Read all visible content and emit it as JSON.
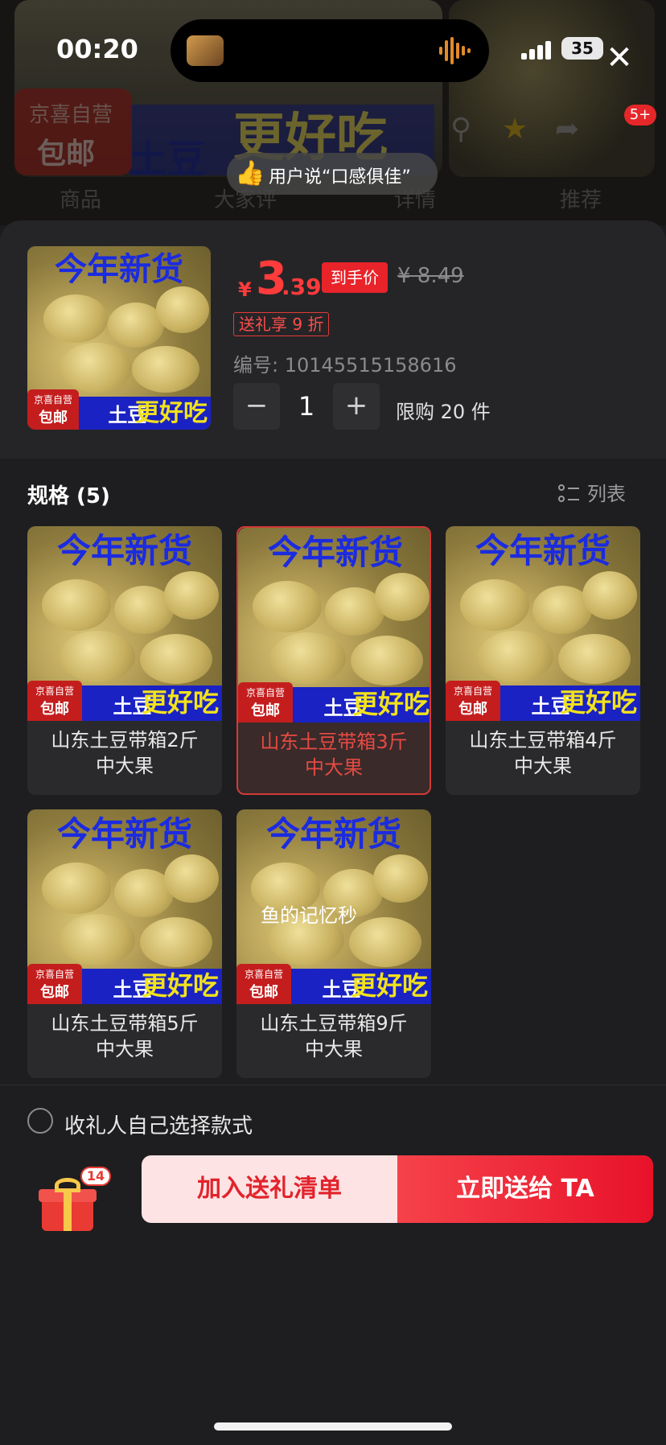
{
  "status_bar": {
    "time": "00:20",
    "battery": "35"
  },
  "background_page": {
    "badge_line1": "京喜自营",
    "badge_line2": "包邮",
    "banner_big": "更好吃",
    "banner_small": "土豆",
    "tabs": [
      "商品",
      "大家评",
      "详情",
      "推荐"
    ],
    "cart_badge": "5+",
    "toast_text": "用户说“口感俱佳”"
  },
  "product": {
    "image_top_text": "今年新货",
    "image_badge_line1": "京喜自营",
    "image_badge_line2": "包邮",
    "image_strip_white": "土豆",
    "image_strip_yellow": "更好吃",
    "currency": "¥",
    "price_int": "3",
    "price_dec": ".39",
    "price_tag": "到手价",
    "original_price": "¥ 8.49",
    "gift_discount": "送礼享 9 折",
    "sku_no": "编号: 10145515158616",
    "qty_minus": "−",
    "qty_value": "1",
    "qty_plus": "+",
    "purchase_limit": "限购 20 件"
  },
  "specs": {
    "title": "规格 (5)",
    "list_toggle": "列表",
    "selected_index": 1,
    "items": [
      {
        "line1": "山东土豆带箱2斤",
        "line2": "中大果"
      },
      {
        "line1": "山东土豆带箱3斤",
        "line2": "中大果"
      },
      {
        "line1": "山东土豆带箱4斤",
        "line2": "中大果"
      },
      {
        "line1": "山东土豆带箱5斤",
        "line2": "中大果"
      },
      {
        "line1": "山东土豆带箱9斤",
        "line2": "中大果"
      }
    ]
  },
  "overlay_text": "鱼的记忆秒",
  "receiver": {
    "label": "收礼人自己选择款式"
  },
  "footer": {
    "gift_count": "14",
    "add_button": "加入送礼清单",
    "send_button": "立即送给 TA"
  }
}
